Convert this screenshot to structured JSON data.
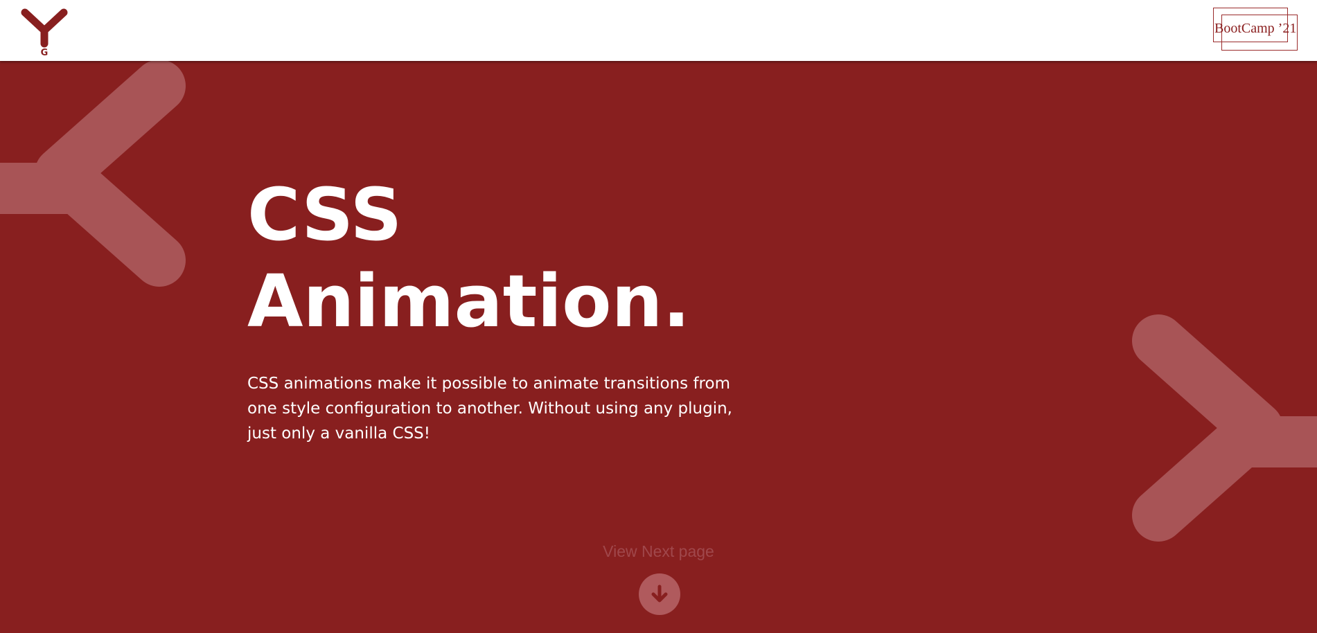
{
  "header": {
    "logo_letter": "G",
    "badge_text": "BootCamp ’21"
  },
  "hero": {
    "title_line1": "CSS",
    "title_line2": "Animation.",
    "description": "CSS animations make it possible to animate transitions from one style configuration to another. Without using any plugin, just only a vanilla CSS!"
  },
  "navigation": {
    "next_label": "View Next page",
    "next_icon": "arrow-down-icon"
  },
  "colors": {
    "background": "#881f1f",
    "header_bg": "#ffffff",
    "accent": "#8a1e1e",
    "decor": "#a85456"
  }
}
